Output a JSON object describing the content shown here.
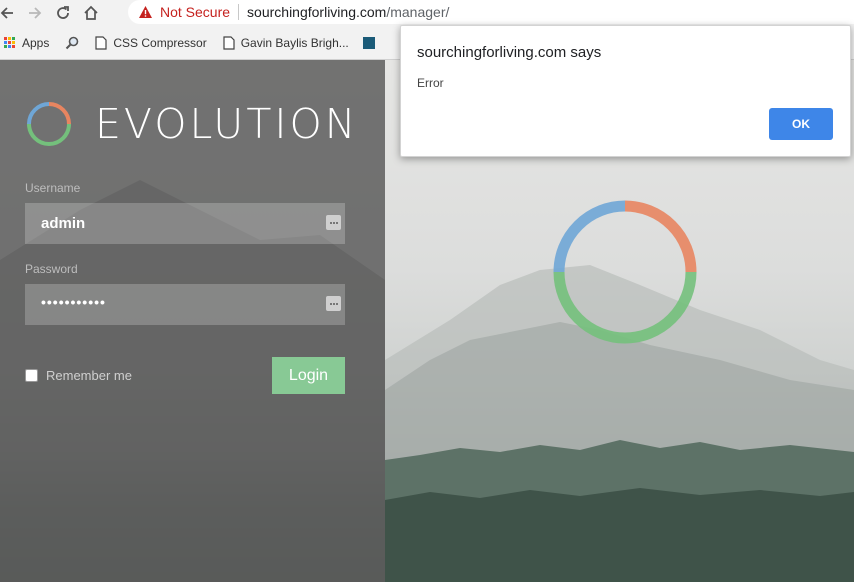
{
  "browser": {
    "security_label": "Not Secure",
    "url_host": "sourchingforliving.com",
    "url_path": "/manager/",
    "bookmarks": [
      {
        "label": "Apps",
        "icon": "apps-grid-icon"
      },
      {
        "label": "",
        "icon": "magnifier-icon"
      },
      {
        "label": "CSS Compressor",
        "icon": "page-icon"
      },
      {
        "label": "Gavin Baylis Brigh...",
        "icon": "page-icon"
      }
    ]
  },
  "login": {
    "brand": "EVOLUTION",
    "username_label": "Username",
    "username_value": "admin",
    "password_label": "Password",
    "password_value": "•••••••••••",
    "remember_label": "Remember me",
    "login_button": "Login"
  },
  "dialog": {
    "title": "sourchingforliving.com says",
    "message": "Error",
    "ok_label": "OK"
  },
  "colors": {
    "login_green": "#88c995",
    "ok_blue": "#3e86e8",
    "not_secure_red": "#c5221f"
  }
}
